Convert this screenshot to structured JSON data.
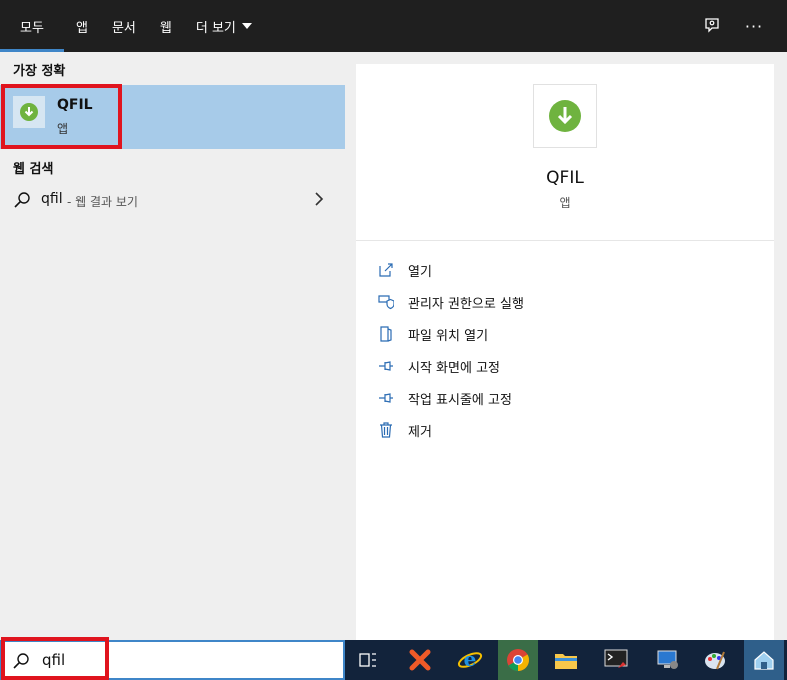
{
  "tabs": [
    {
      "label": "모두",
      "active": true
    },
    {
      "label": "앱"
    },
    {
      "label": "문서"
    },
    {
      "label": "웹"
    },
    {
      "label": "더 보기"
    }
  ],
  "header_icons": [
    "feedback-icon",
    "more-icon"
  ],
  "left": {
    "best_match_heading": "가장 정확",
    "best_match": {
      "name": "QFIL",
      "type": "앱"
    },
    "web_heading": "웹 검색",
    "web_result": {
      "query": "qfil",
      "suffix": "- 웹 결과 보기"
    }
  },
  "preview": {
    "name": "QFIL",
    "type": "앱",
    "actions": [
      {
        "label": "열기",
        "icon": "open-icon"
      },
      {
        "label": "관리자 권한으로 실행",
        "icon": "shield-icon"
      },
      {
        "label": "파일 위치 열기",
        "icon": "file-location-icon"
      },
      {
        "label": "시작 화면에 고정",
        "icon": "pin-icon"
      },
      {
        "label": "작업 표시줄에 고정",
        "icon": "pin-icon"
      },
      {
        "label": "제거",
        "icon": "trash-icon"
      }
    ]
  },
  "search": {
    "value": "qfil"
  },
  "colors": {
    "accent": "#3f86c8",
    "highlight": "#a7cbe9",
    "annotation": "#e0141e",
    "taskbar": "#12233b"
  }
}
